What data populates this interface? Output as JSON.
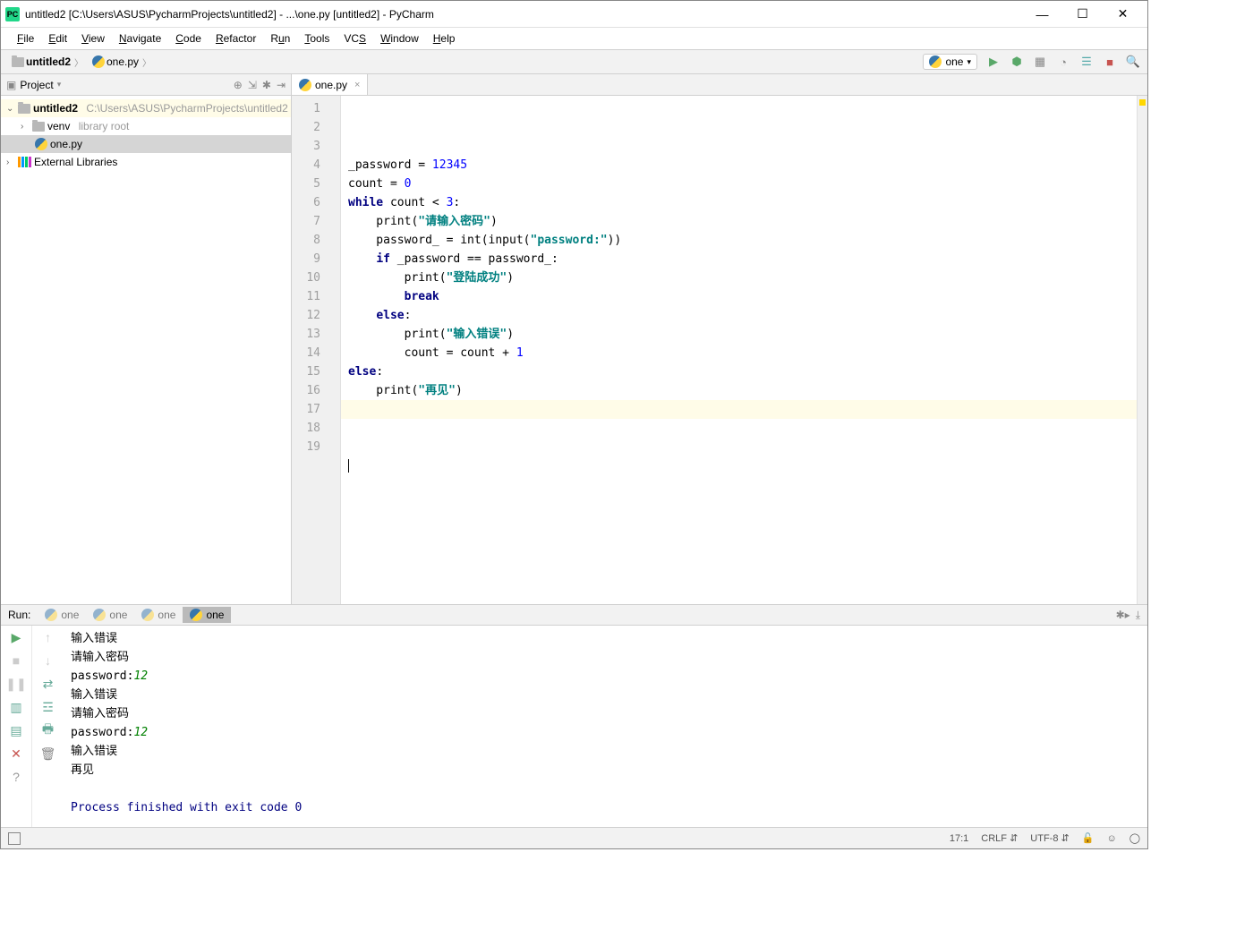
{
  "title": "untitled2 [C:\\Users\\ASUS\\PycharmProjects\\untitled2] - ...\\one.py [untitled2] - PyCharm",
  "menu": [
    "File",
    "Edit",
    "View",
    "Navigate",
    "Code",
    "Refactor",
    "Run",
    "Tools",
    "VCS",
    "Window",
    "Help"
  ],
  "breadcrumb": {
    "root": "untitled2",
    "file": "one.py"
  },
  "runConfig": "one",
  "projectPanel": {
    "title": "Project",
    "root": "untitled2",
    "rootPath": "C:\\Users\\ASUS\\PycharmProjects\\untitled2",
    "venv": "venv",
    "venvNote": "library root",
    "file": "one.py",
    "extLibs": "External Libraries"
  },
  "editor": {
    "tab": "one.py",
    "lines": [
      "1",
      "2",
      "3",
      "4",
      "5",
      "6",
      "7",
      "8",
      "9",
      "10",
      "11",
      "12",
      "13",
      "14",
      "15",
      "16",
      "17",
      "18",
      "19"
    ],
    "currentLine": 17,
    "code": {
      "l1a": "_password = ",
      "l1b": "12345",
      "l2a": "count = ",
      "l2b": "0",
      "l3a": "while",
      "l3b": " count < ",
      "l3c": "3",
      "l3d": ":",
      "l4a": "    print(",
      "l4b": "\"请输入密码\"",
      "l4c": ")",
      "l5a": "    password_ = int(input(",
      "l5b": "\"password:\"",
      "l5c": "))",
      "l6a": "    ",
      "l6b": "if",
      "l6c": " _password == password_:",
      "l7a": "        print(",
      "l7b": "\"登陆成功\"",
      "l7c": ")",
      "l8a": "        ",
      "l8b": "break",
      "l9a": "    ",
      "l9b": "else",
      "l9c": ":",
      "l10a": "        print(",
      "l10b": "\"输入错误\"",
      "l10c": ")",
      "l11a": "        count = count + ",
      "l11b": "1",
      "l12a": "else",
      "l12b": ":",
      "l13a": "    print(",
      "l13b": "\"再见\"",
      "l13c": ")"
    }
  },
  "runPanel": {
    "label": "Run:",
    "tabs": [
      "one",
      "one",
      "one",
      "one"
    ],
    "activeTab": 3,
    "output": {
      "l1": "输入错误",
      "l2": "请输入密码",
      "l3a": "password:",
      "l3b": "12",
      "l4": "输入错误",
      "l5": "请输入密码",
      "l6a": "password:",
      "l6b": "12",
      "l7": "输入错误",
      "l8": "再见",
      "exit": "Process finished with exit code 0"
    }
  },
  "status": {
    "pos": "17:1",
    "crlf": "CRLF",
    "enc": "UTF-8"
  }
}
